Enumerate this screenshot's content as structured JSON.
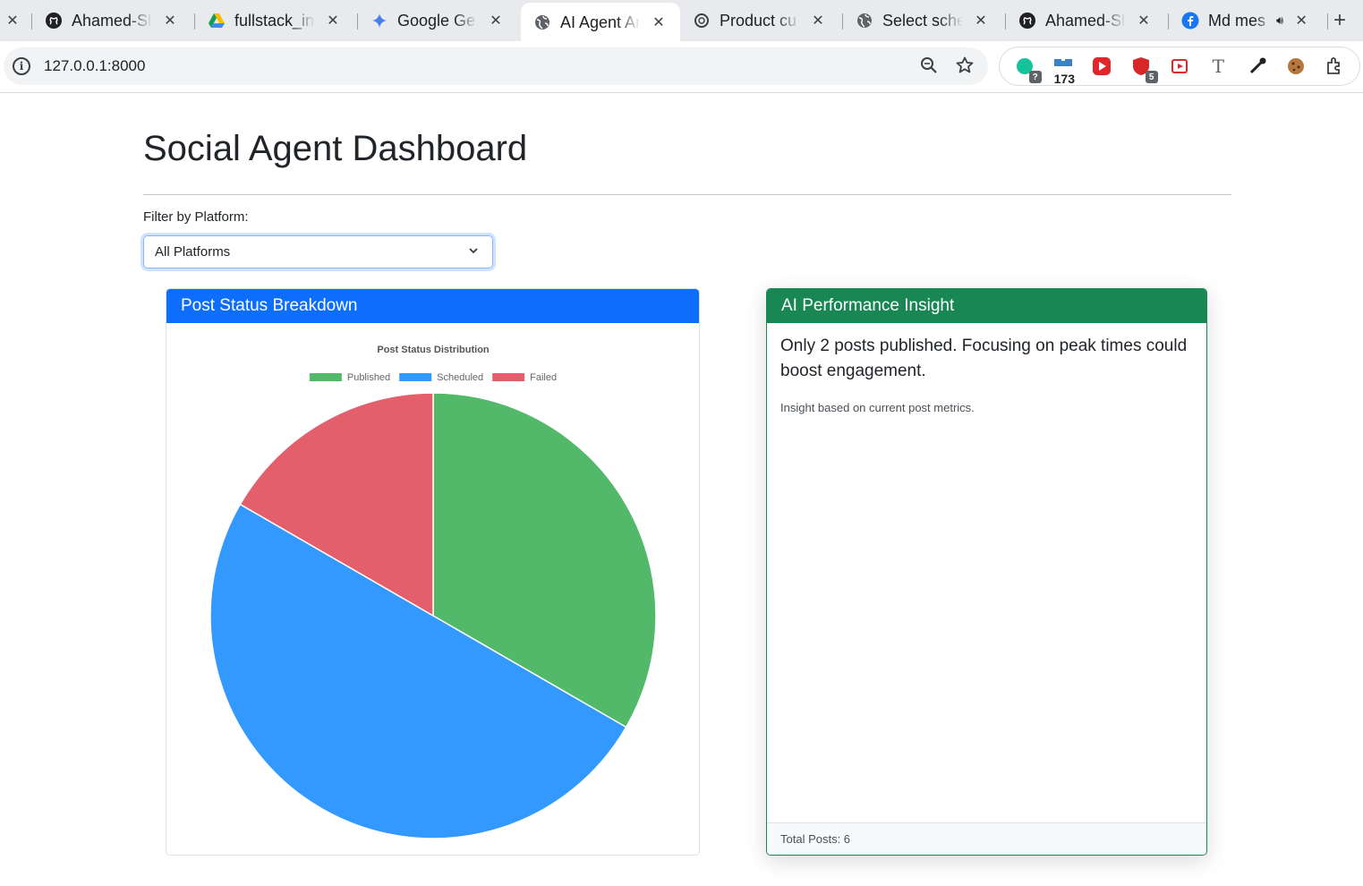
{
  "browser": {
    "tabs": [
      {
        "label": "",
        "icon": "close-icon",
        "active": false
      },
      {
        "label": "Ahamed-Sh",
        "icon": "github-icon",
        "active": false
      },
      {
        "label": "fullstack_in",
        "icon": "google-drive-icon",
        "active": false
      },
      {
        "label": "Google Ge",
        "icon": "gemini-icon",
        "active": false
      },
      {
        "label": "AI Agent Ar",
        "icon": "globe-icon",
        "active": true
      },
      {
        "label": "Product cu",
        "icon": "openai-icon",
        "active": false
      },
      {
        "label": "Select sche",
        "icon": "globe-icon",
        "active": false
      },
      {
        "label": "Ahamed-Sh",
        "icon": "github-icon",
        "active": false
      },
      {
        "label": "Md mes",
        "icon": "facebook-icon",
        "active": false
      }
    ],
    "url": "127.0.0.1:8000",
    "extensions": [
      {
        "name": "grammar-ext-icon",
        "badge": "?"
      },
      {
        "name": "calendar-ext-icon",
        "badge": "173"
      },
      {
        "name": "video-ext-icon",
        "badge": ""
      },
      {
        "name": "shield-ext-icon",
        "badge": "5"
      },
      {
        "name": "youtube-ext-icon",
        "badge": ""
      },
      {
        "name": "font-ext-icon",
        "badge": ""
      },
      {
        "name": "eyedropper-ext-icon",
        "badge": ""
      },
      {
        "name": "cookie-ext-icon",
        "badge": ""
      },
      {
        "name": "puzzle-ext-icon",
        "badge": ""
      }
    ]
  },
  "page": {
    "title": "Social Agent Dashboard",
    "filter_label": "Filter by Platform:",
    "filter_value": "All Platforms"
  },
  "status_card": {
    "header": "Post Status Breakdown"
  },
  "insight_card": {
    "header": "AI Performance Insight",
    "text": "Only 2 posts published. Focusing on peak times could boost engagement.",
    "note": "Insight based on current post metrics.",
    "footer": "Total Posts: 6"
  },
  "chart_data": {
    "type": "pie",
    "title": "Post Status Distribution",
    "categories": [
      "Published",
      "Scheduled",
      "Failed"
    ],
    "values": [
      2,
      3,
      1
    ],
    "colors": [
      "#52b96a",
      "#3399ff",
      "#e35f6b"
    ],
    "legend": "top"
  }
}
